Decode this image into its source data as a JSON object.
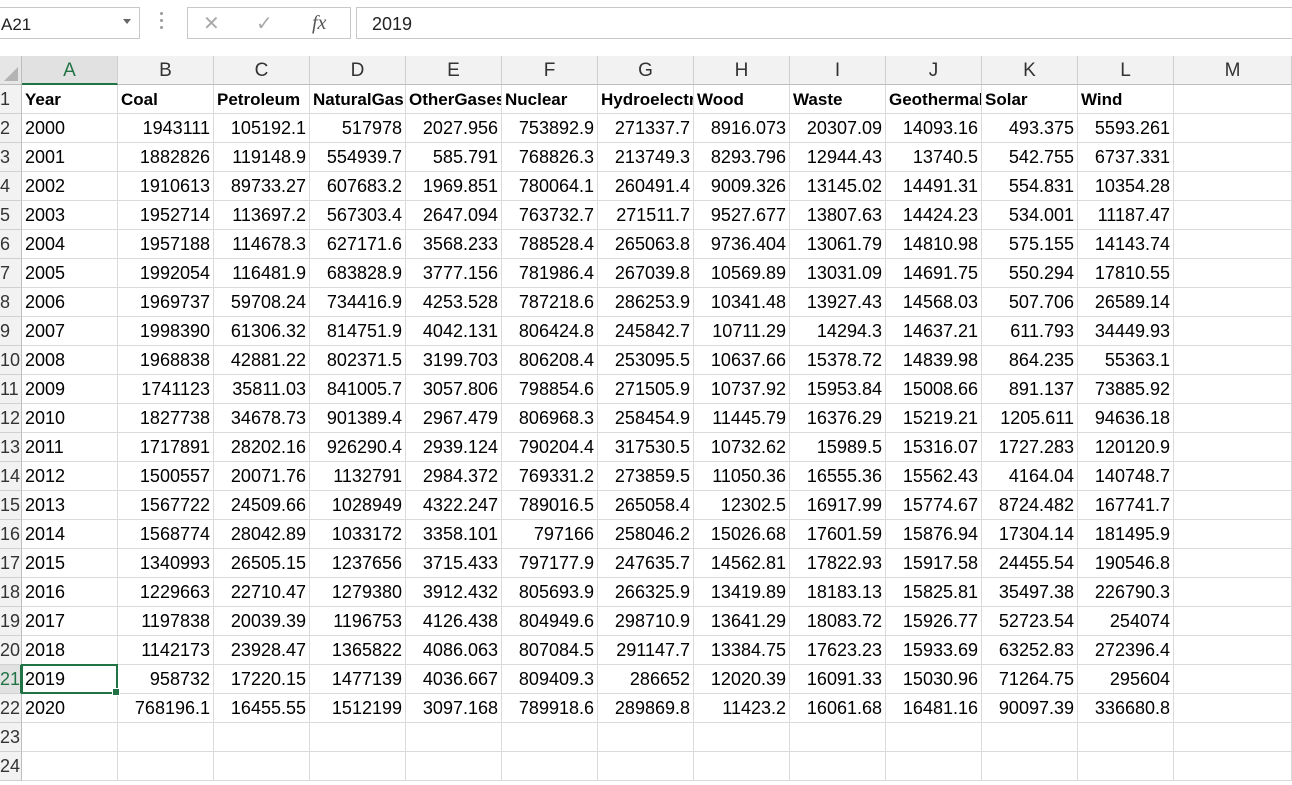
{
  "formula_bar": {
    "name_box": "A21",
    "cancel_icon": "✕",
    "enter_icon": "✓",
    "fx_label": "fx",
    "formula": "2019"
  },
  "grid": {
    "columns": [
      "A",
      "B",
      "C",
      "D",
      "E",
      "F",
      "G",
      "H",
      "I",
      "J",
      "K",
      "L",
      "M"
    ],
    "row_labels": [
      "1",
      "2",
      "3",
      "4",
      "5",
      "6",
      "7",
      "8",
      "9",
      "10",
      "11",
      "12",
      "13",
      "14",
      "15",
      "16",
      "17",
      "18",
      "19",
      "20",
      "21",
      "22",
      "23",
      "24"
    ],
    "selected_column": "A",
    "selected_row": "21",
    "selected_cell": "A21",
    "header_row": [
      "Year",
      "Coal",
      "Petroleum",
      "NaturalGas",
      "OtherGases",
      "Nuclear",
      "Hydroelectric",
      "Wood",
      "Waste",
      "Geothermal",
      "Solar",
      "Wind"
    ],
    "rows": [
      [
        "2000",
        "1943111",
        "105192.1",
        "517978",
        "2027.956",
        "753892.9",
        "271337.7",
        "8916.073",
        "20307.09",
        "14093.16",
        "493.375",
        "5593.261"
      ],
      [
        "2001",
        "1882826",
        "119148.9",
        "554939.7",
        "585.791",
        "768826.3",
        "213749.3",
        "8293.796",
        "12944.43",
        "13740.5",
        "542.755",
        "6737.331"
      ],
      [
        "2002",
        "1910613",
        "89733.27",
        "607683.2",
        "1969.851",
        "780064.1",
        "260491.4",
        "9009.326",
        "13145.02",
        "14491.31",
        "554.831",
        "10354.28"
      ],
      [
        "2003",
        "1952714",
        "113697.2",
        "567303.4",
        "2647.094",
        "763732.7",
        "271511.7",
        "9527.677",
        "13807.63",
        "14424.23",
        "534.001",
        "11187.47"
      ],
      [
        "2004",
        "1957188",
        "114678.3",
        "627171.6",
        "3568.233",
        "788528.4",
        "265063.8",
        "9736.404",
        "13061.79",
        "14810.98",
        "575.155",
        "14143.74"
      ],
      [
        "2005",
        "1992054",
        "116481.9",
        "683828.9",
        "3777.156",
        "781986.4",
        "267039.8",
        "10569.89",
        "13031.09",
        "14691.75",
        "550.294",
        "17810.55"
      ],
      [
        "2006",
        "1969737",
        "59708.24",
        "734416.9",
        "4253.528",
        "787218.6",
        "286253.9",
        "10341.48",
        "13927.43",
        "14568.03",
        "507.706",
        "26589.14"
      ],
      [
        "2007",
        "1998390",
        "61306.32",
        "814751.9",
        "4042.131",
        "806424.8",
        "245842.7",
        "10711.29",
        "14294.3",
        "14637.21",
        "611.793",
        "34449.93"
      ],
      [
        "2008",
        "1968838",
        "42881.22",
        "802371.5",
        "3199.703",
        "806208.4",
        "253095.5",
        "10637.66",
        "15378.72",
        "14839.98",
        "864.235",
        "55363.1"
      ],
      [
        "2009",
        "1741123",
        "35811.03",
        "841005.7",
        "3057.806",
        "798854.6",
        "271505.9",
        "10737.92",
        "15953.84",
        "15008.66",
        "891.137",
        "73885.92"
      ],
      [
        "2010",
        "1827738",
        "34678.73",
        "901389.4",
        "2967.479",
        "806968.3",
        "258454.9",
        "11445.79",
        "16376.29",
        "15219.21",
        "1205.611",
        "94636.18"
      ],
      [
        "2011",
        "1717891",
        "28202.16",
        "926290.4",
        "2939.124",
        "790204.4",
        "317530.5",
        "10732.62",
        "15989.5",
        "15316.07",
        "1727.283",
        "120120.9"
      ],
      [
        "2012",
        "1500557",
        "20071.76",
        "1132791",
        "2984.372",
        "769331.2",
        "273859.5",
        "11050.36",
        "16555.36",
        "15562.43",
        "4164.04",
        "140748.7"
      ],
      [
        "2013",
        "1567722",
        "24509.66",
        "1028949",
        "4322.247",
        "789016.5",
        "265058.4",
        "12302.5",
        "16917.99",
        "15774.67",
        "8724.482",
        "167741.7"
      ],
      [
        "2014",
        "1568774",
        "28042.89",
        "1033172",
        "3358.101",
        "797166",
        "258046.2",
        "15026.68",
        "17601.59",
        "15876.94",
        "17304.14",
        "181495.9"
      ],
      [
        "2015",
        "1340993",
        "26505.15",
        "1237656",
        "3715.433",
        "797177.9",
        "247635.7",
        "14562.81",
        "17822.93",
        "15917.58",
        "24455.54",
        "190546.8"
      ],
      [
        "2016",
        "1229663",
        "22710.47",
        "1279380",
        "3912.432",
        "805693.9",
        "266325.9",
        "13419.89",
        "18183.13",
        "15825.81",
        "35497.38",
        "226790.3"
      ],
      [
        "2017",
        "1197838",
        "20039.39",
        "1196753",
        "4126.438",
        "804949.6",
        "298710.9",
        "13641.29",
        "18083.72",
        "15926.77",
        "52723.54",
        "254074"
      ],
      [
        "2018",
        "1142173",
        "23928.47",
        "1365822",
        "4086.063",
        "807084.5",
        "291147.7",
        "13384.75",
        "17623.23",
        "15933.69",
        "63252.83",
        "272396.4"
      ],
      [
        "2019",
        "958732",
        "17220.15",
        "1477139",
        "4036.667",
        "809409.3",
        "286652",
        "12020.39",
        "16091.33",
        "15030.96",
        "71264.75",
        "295604"
      ],
      [
        "2020",
        "768196.1",
        "16455.55",
        "1512199",
        "3097.168",
        "789918.6",
        "289869.8",
        "11423.2",
        "16061.68",
        "16481.16",
        "90097.39",
        "336680.8"
      ]
    ]
  }
}
